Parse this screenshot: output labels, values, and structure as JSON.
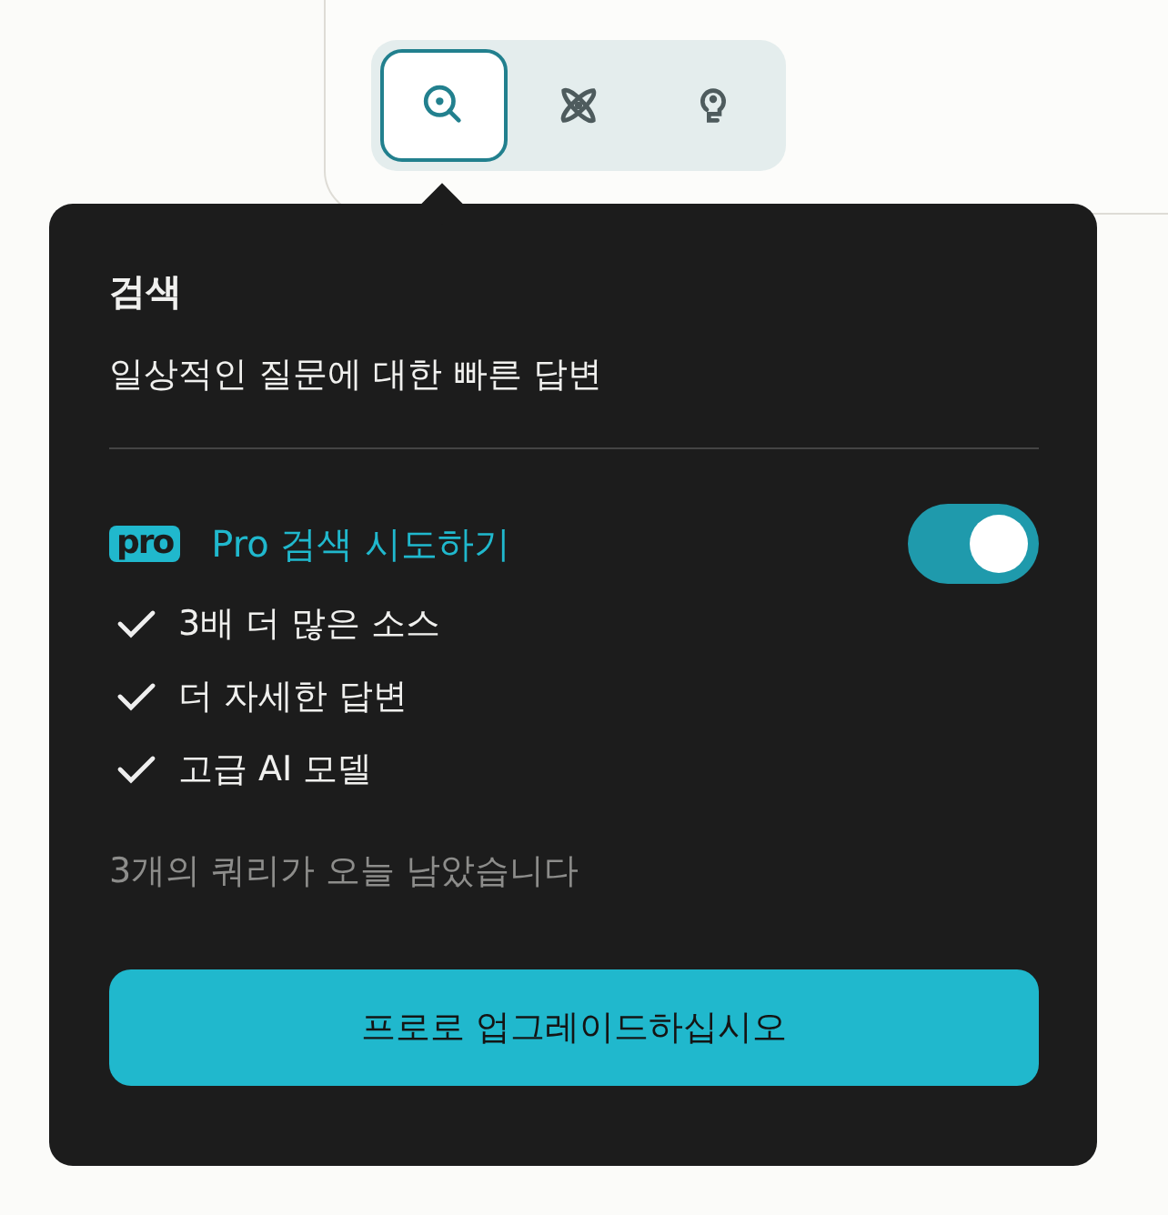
{
  "modes": [
    {
      "kind": "search",
      "selected": true
    },
    {
      "kind": "research",
      "selected": false
    },
    {
      "kind": "reasoning",
      "selected": false
    }
  ],
  "popover": {
    "title": "검색",
    "subtitle": "일상적인 질문에 대한 빠른 답변",
    "pro": {
      "badge": "pro",
      "label": "Pro 검색 시도하기",
      "on": true
    },
    "features": [
      "3배 더 많은 소스",
      "더 자세한 답변",
      "고급 AI 모델"
    ],
    "remaining": "3개의 쿼리가 오늘 남았습니다",
    "upgrade_button": "프로로 업그레이드하십시오"
  }
}
